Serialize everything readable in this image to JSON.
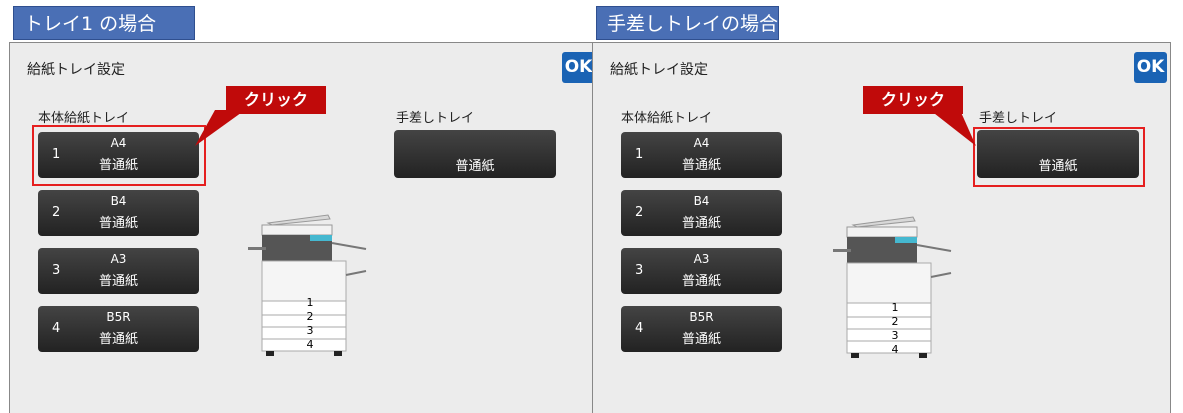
{
  "colors": {
    "accent": "#1a63b4",
    "highlight": "#e51f1f",
    "callout": "#c00a0a",
    "tag": "#4a6fb5"
  },
  "left": {
    "tag": "トレイ1 の場合",
    "title": "給紙トレイ設定",
    "ok": "OK",
    "main_tray_label": "本体給紙トレイ",
    "bypass_label": "手差しトレイ",
    "trays": [
      {
        "num": "1",
        "size": "A4",
        "paper": "普通紙"
      },
      {
        "num": "2",
        "size": "B4",
        "paper": "普通紙"
      },
      {
        "num": "3",
        "size": "A3",
        "paper": "普通紙"
      },
      {
        "num": "4",
        "size": "B5R",
        "paper": "普通紙"
      }
    ],
    "bypass_paper": "普通紙",
    "callout": "クリック",
    "printer_trays": [
      "1",
      "2",
      "3",
      "4"
    ]
  },
  "right": {
    "tag": "手差しトレイの場合",
    "title": "給紙トレイ設定",
    "ok": "OK",
    "main_tray_label": "本体給紙トレイ",
    "bypass_label": "手差しトレイ",
    "trays": [
      {
        "num": "1",
        "size": "A4",
        "paper": "普通紙"
      },
      {
        "num": "2",
        "size": "B4",
        "paper": "普通紙"
      },
      {
        "num": "3",
        "size": "A3",
        "paper": "普通紙"
      },
      {
        "num": "4",
        "size": "B5R",
        "paper": "普通紙"
      }
    ],
    "bypass_paper": "普通紙",
    "callout": "クリック",
    "printer_trays": [
      "1",
      "2",
      "3",
      "4"
    ]
  }
}
